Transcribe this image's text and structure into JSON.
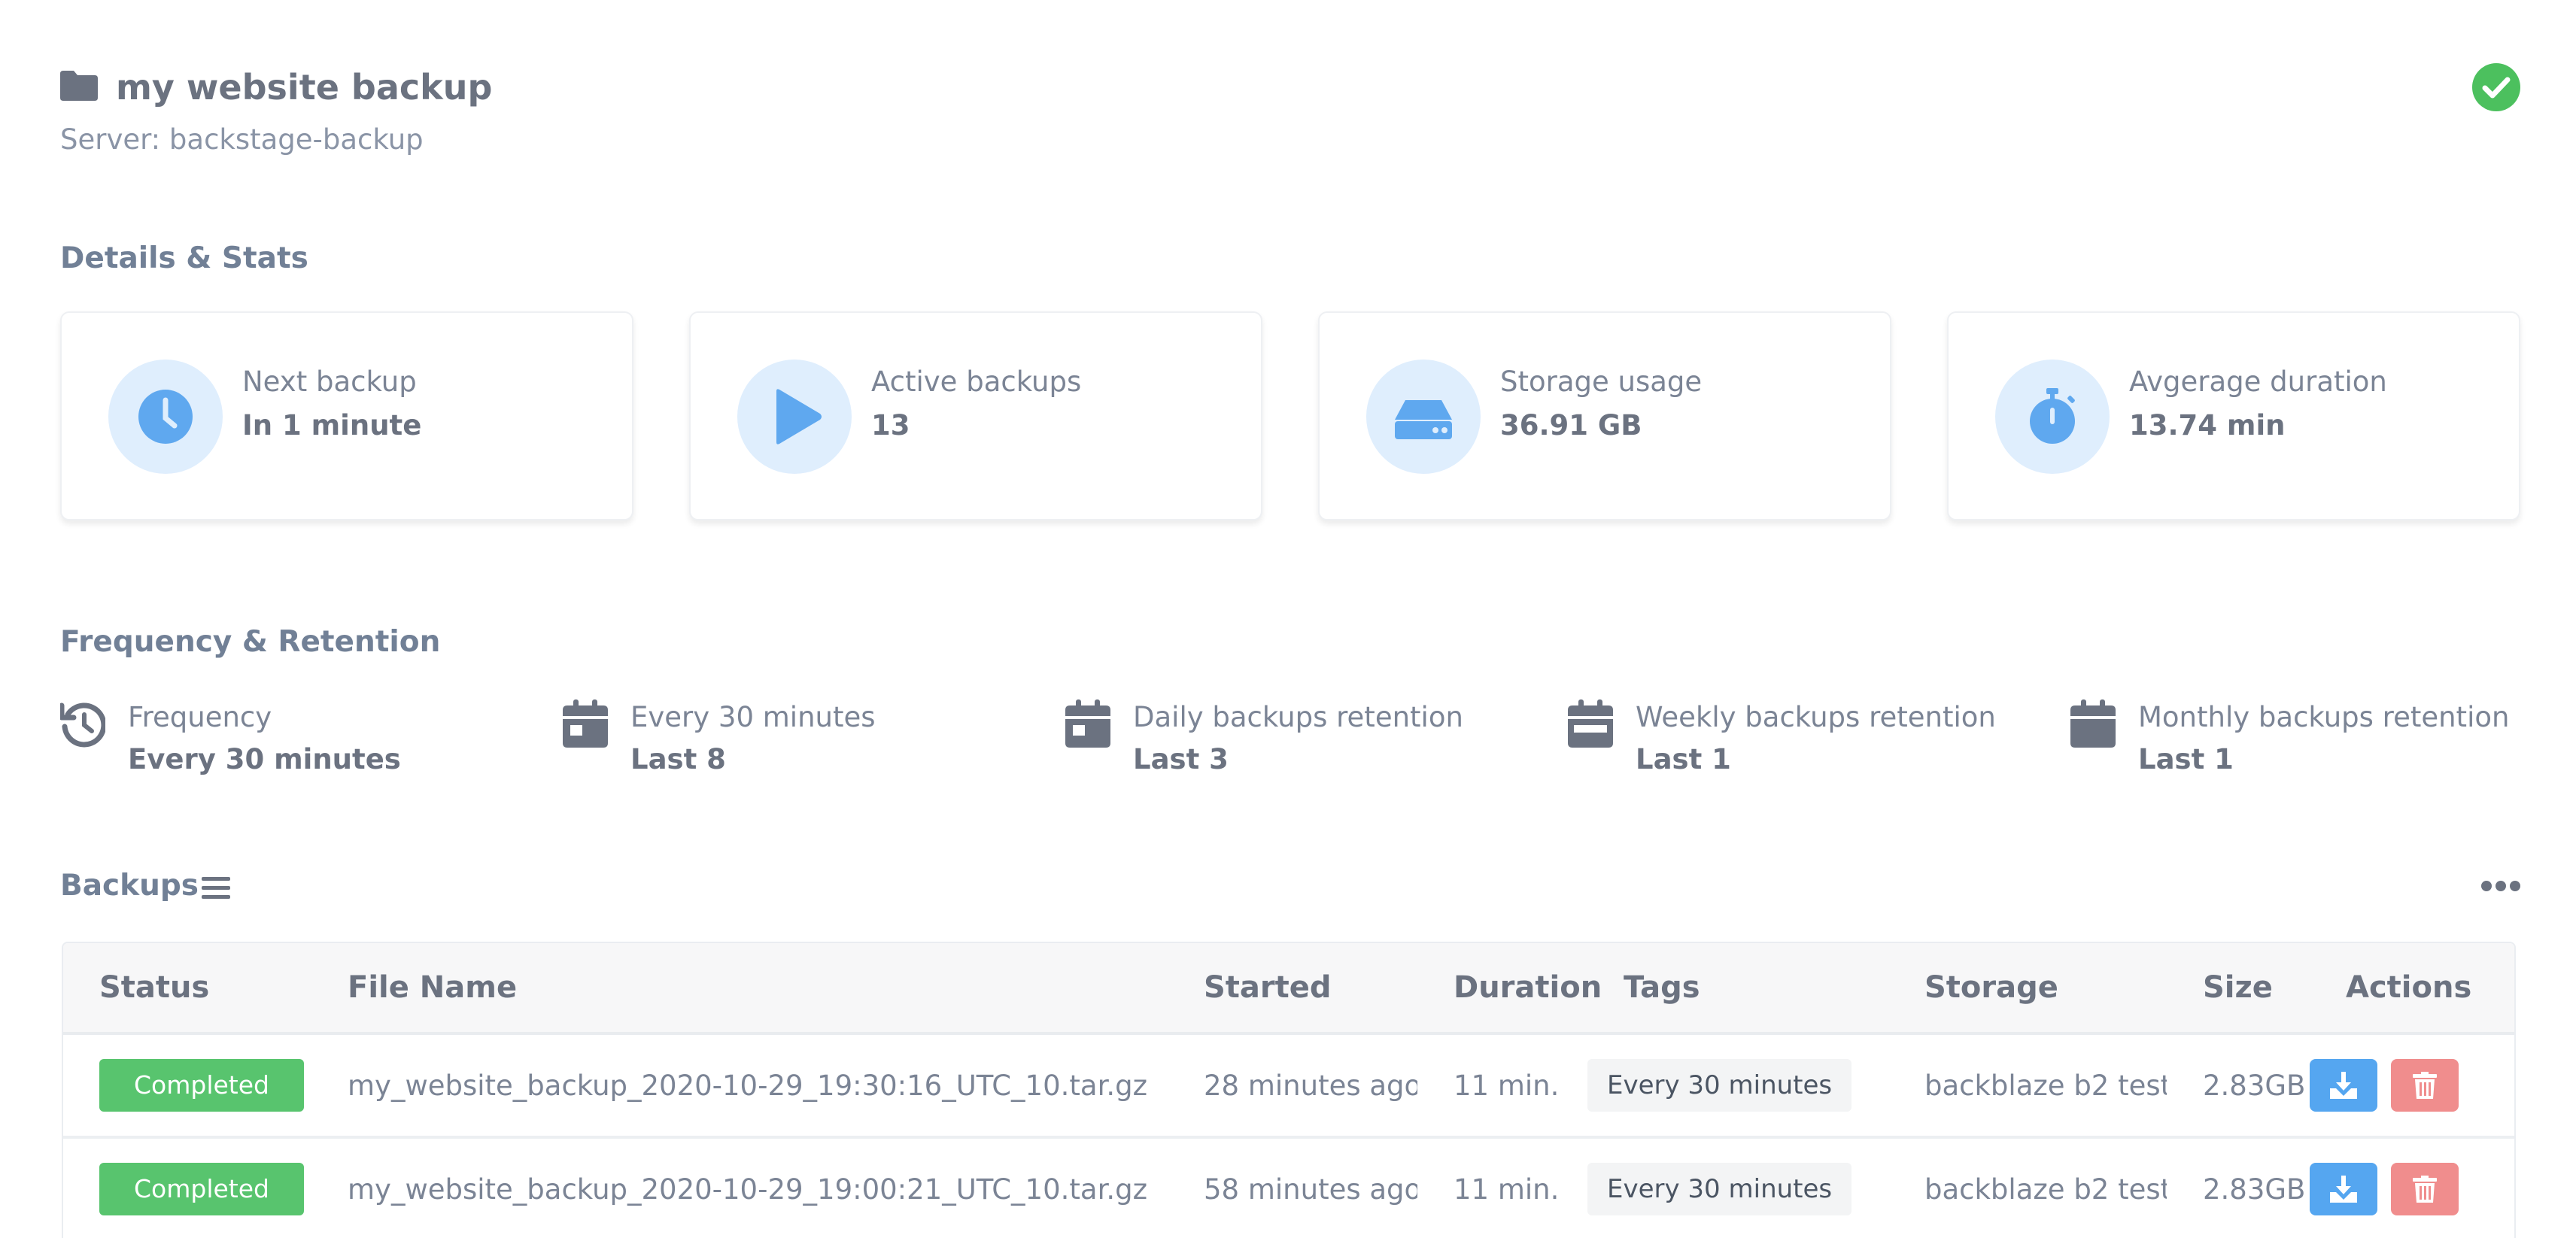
{
  "header": {
    "title": "my website backup",
    "server": "Server: backstage-backup",
    "status_icon": "check-circle-icon",
    "status_color": "#4cc05e"
  },
  "details": {
    "title": "Details & Stats",
    "cards": [
      {
        "icon": "clock-icon",
        "label": "Next backup",
        "value": "In 1 minute"
      },
      {
        "icon": "play-icon",
        "label": "Active backups",
        "value": "13"
      },
      {
        "icon": "hard-drive-icon",
        "label": "Storage usage",
        "value": "36.91 GB"
      },
      {
        "icon": "stopwatch-icon",
        "label": "Avgerage duration",
        "value": "13.74 min"
      }
    ]
  },
  "frequency": {
    "title": "Frequency & Retention",
    "items": [
      {
        "icon": "history-icon",
        "label": "Frequency",
        "value": "Every 30 minutes"
      },
      {
        "icon": "calendar-icon",
        "label": "Every 30 minutes",
        "value": "Last 8"
      },
      {
        "icon": "calendar-icon",
        "label": "Daily backups retention",
        "value": "Last 3"
      },
      {
        "icon": "calendar-icon",
        "label": "Weekly backups retention",
        "value": "Last 1"
      },
      {
        "icon": "calendar-icon",
        "label": "Monthly backups retention",
        "value": "Last 1"
      }
    ]
  },
  "backups": {
    "title": "Backups",
    "columns": [
      "Status",
      "File Name",
      "Started",
      "Duration",
      "Tags",
      "Storage",
      "Size",
      "Actions"
    ],
    "rows": [
      {
        "status": "Completed",
        "file": "my_website_backup_2020-10-29_19:30:16_UTC_10.tar.gz",
        "started": "28 minutes ago",
        "duration": "11 min.",
        "tag": "Every 30 minutes",
        "storage": "backblaze b2 test",
        "size": "2.83GB"
      },
      {
        "status": "Completed",
        "file": "my_website_backup_2020-10-29_19:00:21_UTC_10.tar.gz",
        "started": "58 minutes ago",
        "duration": "11 min.",
        "tag": "Every 30 minutes",
        "storage": "backblaze b2 test",
        "size": "2.83GB"
      }
    ]
  },
  "colors": {
    "accent": "#5fa8ef",
    "icon_bg": "#dfeefd",
    "success": "#58c46e",
    "danger": "#f08d8d"
  }
}
